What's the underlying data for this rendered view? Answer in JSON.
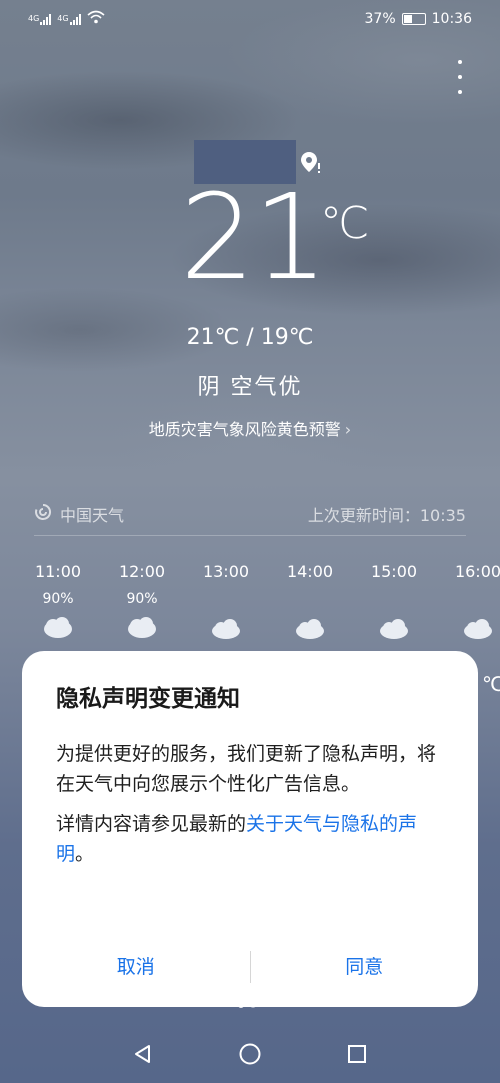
{
  "status_bar": {
    "signal1_label": "4G",
    "signal2_label": "4G",
    "battery_percent": "37%",
    "battery_level": 0.37,
    "time": "10:36"
  },
  "weather": {
    "current_temp": "21",
    "temp_unit": "℃",
    "high_low": "21℃ / 19℃",
    "condition": "阴  空气优",
    "warning": "地质灾害气象风险黄色预警",
    "warning_chevron": "›"
  },
  "source": {
    "provider": "中国天气",
    "updated": "上次更新时间：10:35"
  },
  "hourly": [
    {
      "time": "11:00",
      "prob": "90%",
      "icon": "rain-cloud-icon"
    },
    {
      "time": "12:00",
      "prob": "90%",
      "icon": "rain-cloud-icon"
    },
    {
      "time": "13:00",
      "prob": "",
      "icon": "cloud-icon"
    },
    {
      "time": "14:00",
      "prob": "",
      "icon": "cloud-icon"
    },
    {
      "time": "15:00",
      "prob": "",
      "icon": "cloud-icon"
    },
    {
      "time": "16:00",
      "prob": "",
      "icon": "cloud-icon"
    }
  ],
  "partial_temp_unit": "℃",
  "dialog": {
    "title": "隐私声明变更通知",
    "body1": "为提供更好的服务，我们更新了隐私声明，将在天气中向您展示个性化广告信息。",
    "body2_prefix": "详情内容请参见最新的",
    "body2_link": "关于天气与隐私的声明",
    "body2_suffix": "。",
    "cancel_label": "取消",
    "agree_label": "同意"
  },
  "colors": {
    "accent": "#1a73e8",
    "city_placeholder": "#4f5f80"
  }
}
